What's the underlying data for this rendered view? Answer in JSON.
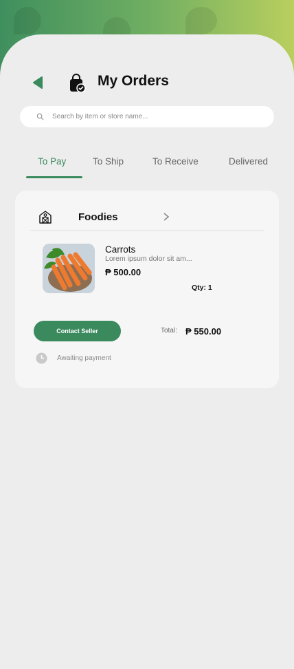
{
  "header": {
    "title": "My Orders"
  },
  "search": {
    "placeholder": "Search by item or store name..."
  },
  "tabs": [
    {
      "label": "To Pay",
      "active": true
    },
    {
      "label": "To Ship",
      "active": false
    },
    {
      "label": "To Receive",
      "active": false
    },
    {
      "label": "Delivered",
      "active": false
    }
  ],
  "order": {
    "store": {
      "name": "Foodies",
      "icon": "barn-store-icon"
    },
    "item": {
      "name": "Carrots",
      "description": "Lorem ipsum dolor sit am...",
      "price": "₱ 500.00",
      "qty_label": "Qty: 1"
    },
    "contact_label": "Contact Seller",
    "total_label": "Total:",
    "total_value": "₱ 550.00",
    "status": "Awaiting payment"
  },
  "colors": {
    "accent": "#3a8a5e",
    "background": "#ededed",
    "card": "#f6f6f6"
  }
}
